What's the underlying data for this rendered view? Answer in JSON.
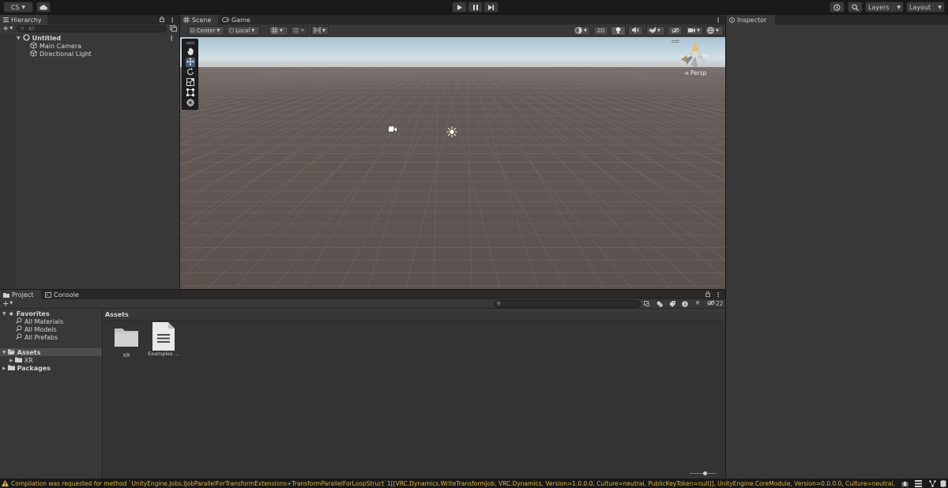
{
  "toolbar": {
    "account_label": "CS",
    "layers_label": "Layers",
    "layout_label": "Layout"
  },
  "hierarchy": {
    "title": "Hierarchy",
    "search_placeholder": "All",
    "scene_name": "Untitled",
    "items": [
      "Main Camera",
      "Directional Light"
    ]
  },
  "scene_view": {
    "tabs": [
      "Scene",
      "Game"
    ],
    "pivot_label": "Center",
    "space_label": "Local",
    "mode_2d_label": "2D",
    "projection_label": "Persp"
  },
  "inspector": {
    "title": "Inspector"
  },
  "project": {
    "tabs": [
      "Project",
      "Console"
    ],
    "favorites_label": "Favorites",
    "favorites": [
      "All Materials",
      "All Models",
      "All Prefabs"
    ],
    "assets_label": "Assets",
    "asset_folders": [
      "XR"
    ],
    "packages_label": "Packages",
    "breadcrumb": "Assets",
    "grid_items": [
      {
        "label": "XR",
        "icon": "folder-icon"
      },
      {
        "label": "Examples ...",
        "icon": "document-icon"
      }
    ],
    "hidden_count": "22"
  },
  "status": {
    "message": "Compilation was requested for method `UnityEngine.Jobs.IJobParallelForTransformExtensions+TransformParallelForLoopStruct`1[[VRC.Dynamics.WriteTransformJob, VRC.Dynamics, Version=1.0.0.0, Culture=neutral, PublicKeyToken=null]], UnityEngine.CoreModule, Version=0.0.0.0, Culture=neutral, PublicKeyToker"
  },
  "colors": {
    "warning": "#e3b33a",
    "sky_top": "#a9c4d6",
    "ground": "#5e5451",
    "panel": "#383838"
  }
}
